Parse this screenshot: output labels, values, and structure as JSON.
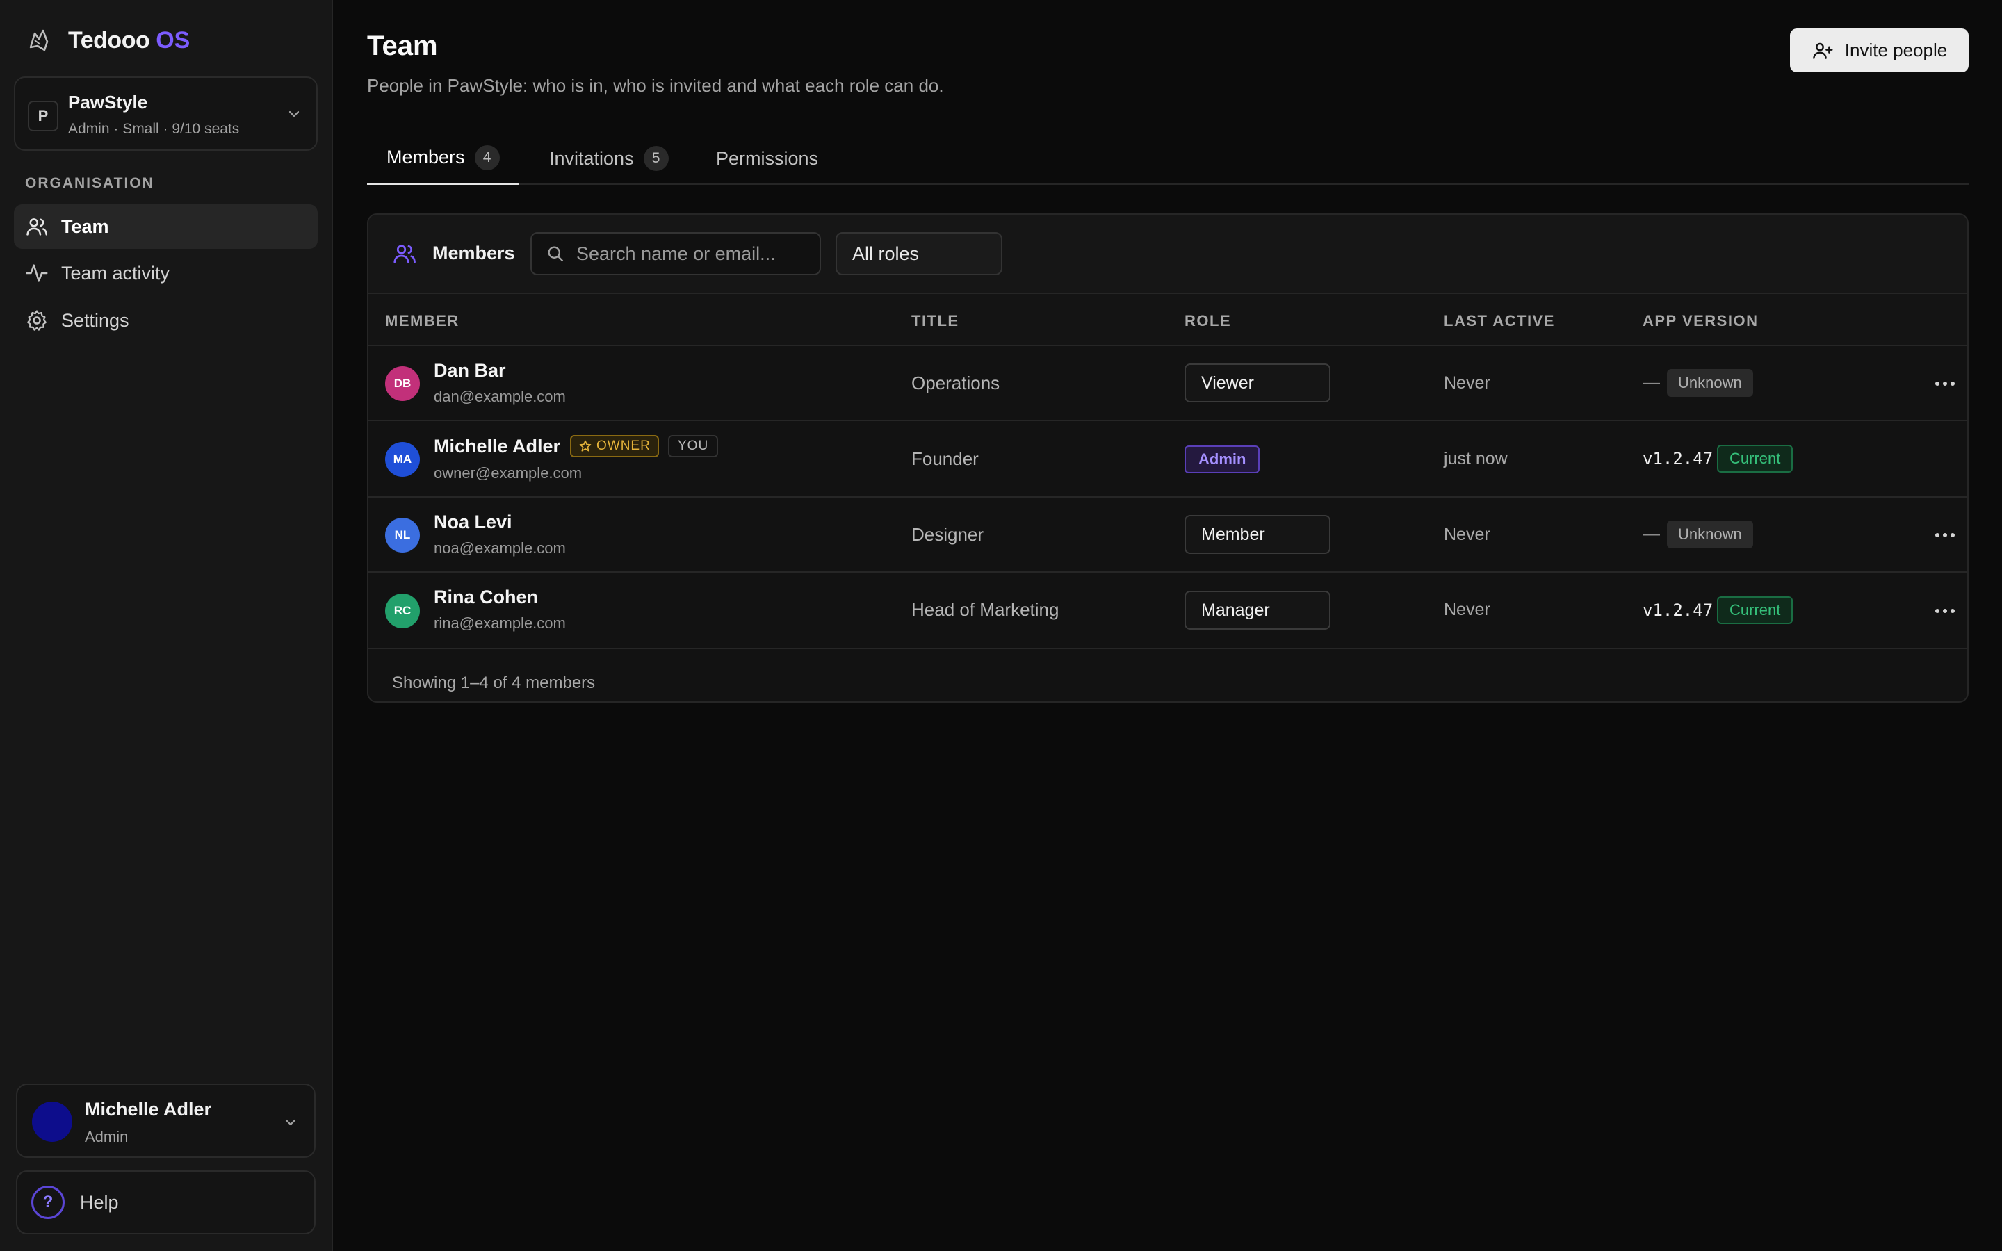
{
  "brand": {
    "name": "Tedooo",
    "suffix": "OS"
  },
  "org": {
    "letter": "P",
    "name": "PawStyle",
    "sub": "Admin · Small · 9/10 seats"
  },
  "sidebar": {
    "section": "ORGANISATION",
    "items": [
      {
        "label": "Team",
        "icon": "users-icon",
        "active": true
      },
      {
        "label": "Team activity",
        "icon": "activity-icon",
        "active": false
      },
      {
        "label": "Settings",
        "icon": "gear-icon",
        "active": false
      }
    ]
  },
  "user": {
    "name": "Michelle Adler",
    "role": "Admin"
  },
  "help": {
    "label": "Help",
    "icon_glyph": "?"
  },
  "page": {
    "title": "Team",
    "subtitle": "People in PawStyle: who is in, who is invited and what each role can do.",
    "invite_label": "Invite people"
  },
  "tabs": [
    {
      "label": "Members",
      "count": "4",
      "active": true
    },
    {
      "label": "Invitations",
      "count": "5",
      "active": false
    },
    {
      "label": "Permissions",
      "count": null,
      "active": false
    }
  ],
  "toolbar": {
    "title": "Members",
    "search_placeholder": "Search name or email...",
    "role_filter": "All roles"
  },
  "table": {
    "headers": [
      "MEMBER",
      "TITLE",
      "ROLE",
      "LAST ACTIVE",
      "APP VERSION"
    ],
    "rows": [
      {
        "initials": "DB",
        "avatar_color": "#c2307a",
        "name": "Dan Bar",
        "email": "dan@example.com",
        "title": "Operations",
        "role": "Viewer",
        "role_editable": true,
        "last_active": "Never",
        "version_dash": "—",
        "version": null,
        "version_status": "Unknown",
        "owner": false,
        "you": false
      },
      {
        "initials": "MA",
        "avatar_color": "#1f4fd8",
        "name": "Michelle Adler",
        "email": "owner@example.com",
        "title": "Founder",
        "role": "Admin",
        "role_editable": false,
        "last_active": "just now",
        "version_dash": null,
        "version": "v1.2.47",
        "version_status": "Current",
        "owner": true,
        "you": true
      },
      {
        "initials": "NL",
        "avatar_color": "#3b6ee0",
        "name": "Noa Levi",
        "email": "noa@example.com",
        "title": "Designer",
        "role": "Member",
        "role_editable": true,
        "last_active": "Never",
        "version_dash": "—",
        "version": null,
        "version_status": "Unknown",
        "owner": false,
        "you": false
      },
      {
        "initials": "RC",
        "avatar_color": "#22a06b",
        "name": "Rina Cohen",
        "email": "rina@example.com",
        "title": "Head of Marketing",
        "role": "Manager",
        "role_editable": true,
        "last_active": "Never",
        "version_dash": null,
        "version": "v1.2.47",
        "version_status": "Current",
        "owner": false,
        "you": false
      }
    ],
    "owner_badge": "OWNER",
    "you_badge": "YOU",
    "footer": "Showing 1–4 of 4 members"
  },
  "colors": {
    "accent": "#7c5cff",
    "background": "#0b0b0b",
    "sidebar": "#171717",
    "success": "#35c07a",
    "owner": "#e5b43a"
  }
}
